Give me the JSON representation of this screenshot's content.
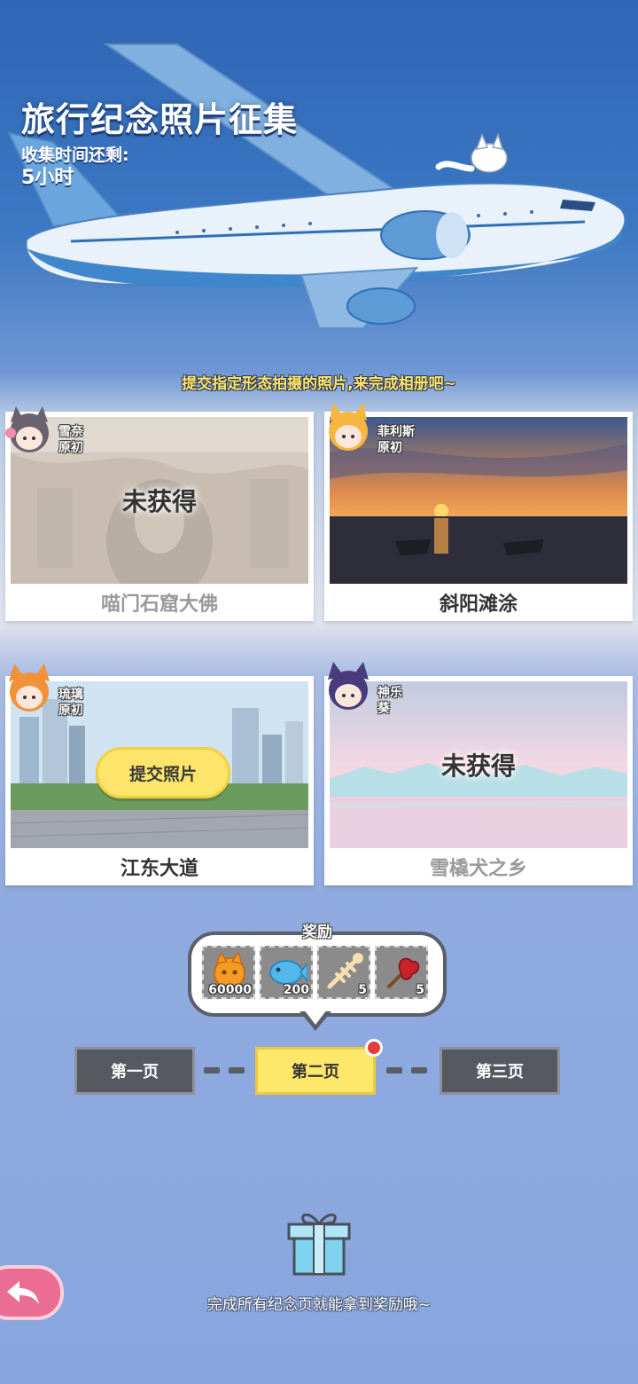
{
  "header": {
    "title": "旅行纪念照片征集",
    "remain_label": "收集时间还剩:",
    "remain_value": "5小时"
  },
  "hint": "提交指定形态拍摄的照片,来完成相册吧~",
  "cards": [
    {
      "character_line1": "雪奈",
      "character_line2": "原初",
      "caption": "喵门石窟大佛",
      "status": "未获得",
      "state": "locked"
    },
    {
      "character_line1": "菲利斯",
      "character_line2": "原初",
      "caption": "斜阳滩涂",
      "state": "obtained"
    },
    {
      "character_line1": "琉璃",
      "character_line2": "原初",
      "caption": "江东大道",
      "submit_label": "提交照片",
      "state": "submittable"
    },
    {
      "character_line1": "神乐",
      "character_line2": "葵",
      "caption": "雪橇犬之乡",
      "status": "未获得",
      "state": "locked"
    }
  ],
  "rewards": {
    "title": "奖励",
    "items": [
      {
        "icon": "cat-coin-icon",
        "count": "60000"
      },
      {
        "icon": "blue-fish-icon",
        "count": "200"
      },
      {
        "icon": "fish-bone-icon",
        "count": "5"
      },
      {
        "icon": "red-flower-icon",
        "count": "5"
      }
    ]
  },
  "pager": {
    "pages": [
      "第一页",
      "第二页",
      "第三页"
    ],
    "active_index": 1
  },
  "footer": {
    "finish_text": "完成所有纪念页就能拿到奖励哦~"
  },
  "colors": {
    "accent_yellow": "#fde86b",
    "notification_red": "#e43b3b",
    "back_button_pink": "#ec6d93"
  }
}
